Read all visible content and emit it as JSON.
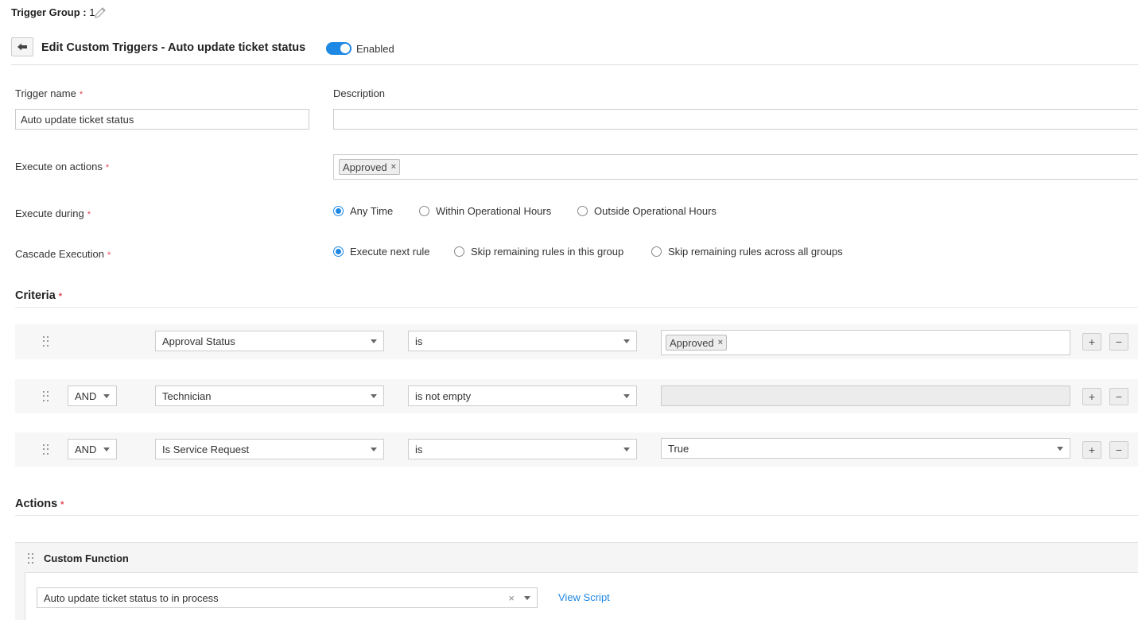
{
  "header": {
    "trigger_group_label": "Trigger Group :",
    "trigger_group_number": "1",
    "page_title": "Edit Custom Triggers - Auto update ticket status",
    "enabled_label": "Enabled",
    "enabled": true
  },
  "form": {
    "trigger_name_label": "Trigger name",
    "trigger_name_value": "Auto update ticket status",
    "description_label": "Description",
    "description_value": "",
    "execute_on_label": "Execute on actions",
    "execute_on_chip": "Approved",
    "execute_during_label": "Execute during",
    "execute_during_options": [
      "Any Time",
      "Within Operational Hours",
      "Outside Operational Hours"
    ],
    "execute_during_selected": 0,
    "cascade_label": "Cascade Execution",
    "cascade_options": [
      "Execute next rule",
      "Skip remaining rules in this group",
      "Skip remaining rules across all groups"
    ],
    "cascade_selected": 0
  },
  "criteria": {
    "title": "Criteria",
    "rows": [
      {
        "connector": "",
        "field": "Approval Status",
        "operator": "is",
        "value_chip": "Approved"
      },
      {
        "connector": "AND",
        "field": "Technician",
        "operator": "is not empty",
        "value": ""
      },
      {
        "connector": "AND",
        "field": "Is Service Request",
        "operator": "is",
        "value": "True"
      }
    ]
  },
  "actions": {
    "title": "Actions",
    "custom_function_title": "Custom Function",
    "function_value": "Auto update ticket status to in process",
    "view_script_label": "View Script"
  },
  "colors": {
    "accent": "#1e88e5",
    "required": "#e0454f"
  }
}
